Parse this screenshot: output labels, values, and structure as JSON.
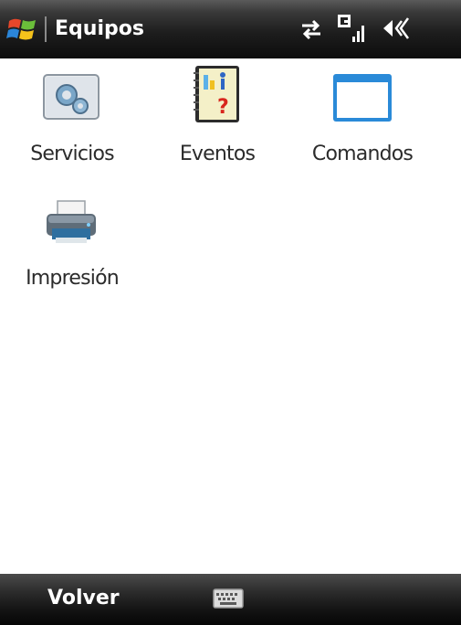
{
  "title_bar": {
    "app_title": "Equipos",
    "icons": [
      "windows-start-icon",
      "data-sync-icon",
      "signal-g-icon",
      "volume-icon"
    ]
  },
  "tiles": [
    {
      "label": "Servicios",
      "icon": "gears-icon"
    },
    {
      "label": "Eventos",
      "icon": "notebook-question-icon"
    },
    {
      "label": "Comandos",
      "icon": "window-icon"
    },
    {
      "label": "Impresión",
      "icon": "printer-icon"
    }
  ],
  "soft_keys": {
    "left": "Volver",
    "center_icon": "keyboard-icon"
  },
  "colors": {
    "bar_dark": "#111111",
    "window_blue": "#2a8ad8",
    "text": "#2b2b2b"
  }
}
